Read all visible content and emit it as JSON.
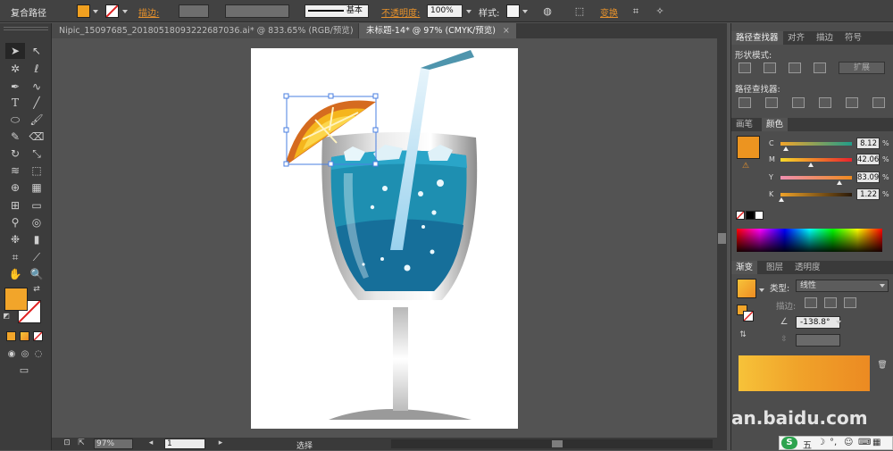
{
  "control_bar": {
    "selection_label": "复合路径",
    "stroke_label": "描边:",
    "stroke_style": "基本",
    "opacity_label": "不透明度:",
    "opacity_value": "100%",
    "style_label": "样式:",
    "transform_label": "变换",
    "fill_color": "#f0a020"
  },
  "tabs": [
    {
      "label": "Nipic_15097685_20180518093222687036.ai* @ 833.65% (RGB/预览)",
      "close": "×"
    },
    {
      "label": "未标题-14* @ 97% (CMYK/预览)",
      "close": "×"
    }
  ],
  "pathfinder": {
    "tabs": [
      "路径查找器",
      "对齐",
      "描边",
      "符号"
    ],
    "shape_modes_label": "形状模式:",
    "expand_label": "扩展",
    "pathfinders_label": "路径查找器:"
  },
  "color": {
    "tabs": [
      "画笔",
      "颜色"
    ],
    "swatch": "#ec9420",
    "channels": [
      {
        "name": "C",
        "value": "8.12",
        "fraction": 0.08,
        "track": "linear-gradient(to right,#f3a52a,#1f9d8a)"
      },
      {
        "name": "M",
        "value": "42.06",
        "fraction": 0.42,
        "track": "linear-gradient(to right,#f5d82a,#e9222c)"
      },
      {
        "name": "Y",
        "value": "83.09",
        "fraction": 0.83,
        "track": "linear-gradient(to right,#ef8fb0,#ee8a20)"
      },
      {
        "name": "K",
        "value": "1.22",
        "fraction": 0.01,
        "track": "linear-gradient(to right,#f0a329,#2a1a0a)"
      }
    ],
    "pct": "%"
  },
  "gradient": {
    "tabs": [
      "渐变",
      "图层",
      "透明度"
    ],
    "type_label": "类型:",
    "type_value": "线性",
    "stroke_label": "描边:",
    "angle_value": "-138.8°"
  },
  "status": {
    "zoom": "97%",
    "page": "1",
    "state": "选择"
  },
  "watermark": "an.baidu.com",
  "ime": {
    "logo": "S",
    "label": "五"
  }
}
